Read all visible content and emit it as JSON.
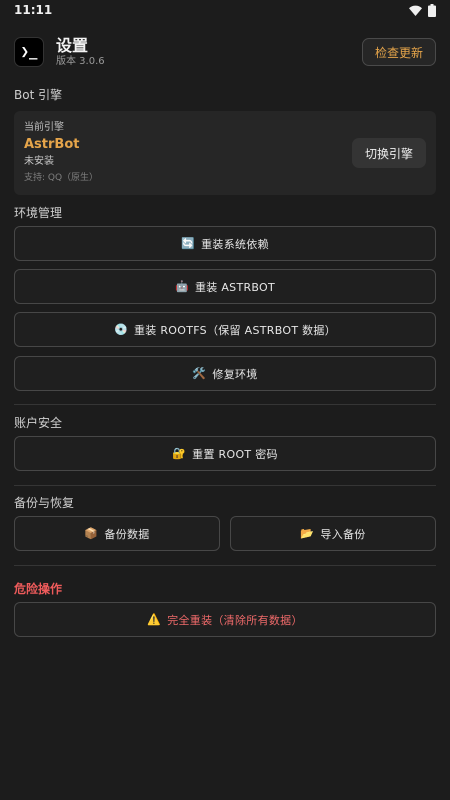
{
  "status_bar": {
    "time": "11:11"
  },
  "header": {
    "app_icon_glyph": "❯_",
    "title": "设置",
    "version": "版本 3.0.6",
    "update_button": "检查更新"
  },
  "bot_engine": {
    "section_title": "Bot 引擎",
    "current_label": "当前引擎",
    "engine_name": "AstrBot",
    "install_status": "未安装",
    "support": "支持: QQ（原生）",
    "switch_button": "切换引擎"
  },
  "environment": {
    "section_title": "环境管理",
    "buttons": [
      {
        "icon": "🔄",
        "label": "重装系统依赖"
      },
      {
        "icon": "🤖",
        "label": "重装 ASTRBOT"
      },
      {
        "icon": "💿",
        "label": "重装 ROOTFS（保留 ASTRBOT 数据）"
      },
      {
        "icon": "🛠️",
        "label": "修复环境"
      }
    ]
  },
  "account": {
    "section_title": "账户安全",
    "reset_root": {
      "icon": "🔐",
      "label": "重置 ROOT 密码"
    }
  },
  "backup": {
    "section_title": "备份与恢复",
    "backup_button": {
      "icon": "📦",
      "label": "备份数据"
    },
    "import_button": {
      "icon": "📂",
      "label": "导入备份"
    }
  },
  "danger": {
    "section_title": "危险操作",
    "full_reinstall": {
      "icon": "⚠️",
      "label": "完全重装（清除所有数据）"
    }
  },
  "colors": {
    "accent": "#e6a54a",
    "danger": "#ef5b5b",
    "background": "#1c1c1c"
  }
}
